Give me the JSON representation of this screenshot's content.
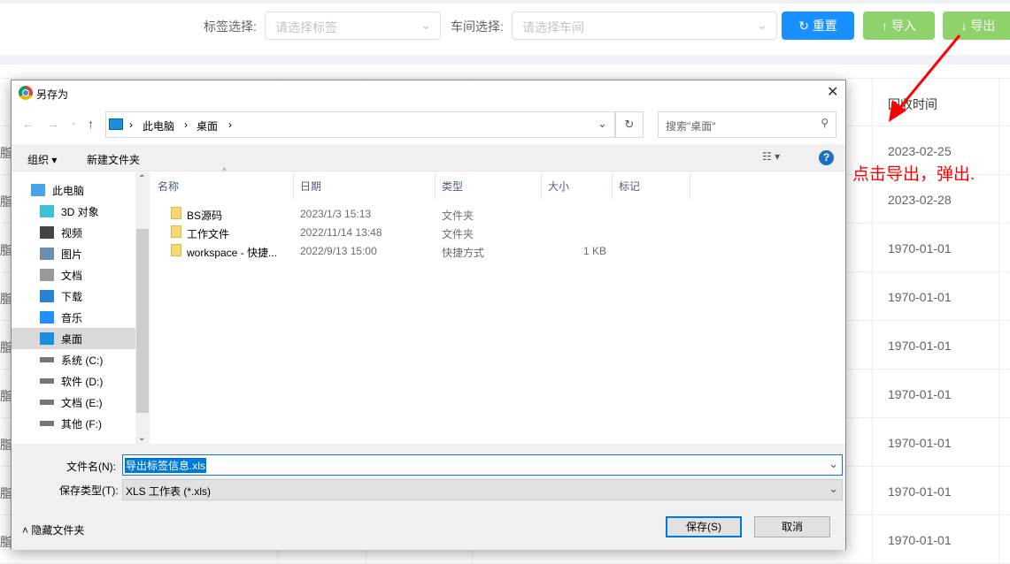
{
  "filters": {
    "tag_label": "标签选择:",
    "tag_placeholder": "请选择标签",
    "workshop_label": "车间选择:",
    "workshop_placeholder": "请选择车间"
  },
  "buttons": {
    "reset": "重置",
    "import": "导入",
    "export": "导出"
  },
  "colors": {
    "primary": "#1890ff",
    "success": "#8fd16a",
    "annotation": "#ff0000"
  },
  "table": {
    "column_header": "回收时间",
    "cut_text": "脂",
    "dates": [
      "2023-02-25",
      "2023-02-28",
      "1970-01-01",
      "1970-01-01",
      "1970-01-01",
      "1970-01-01",
      "1970-01-01",
      "1970-01-01",
      "1970-01-01"
    ]
  },
  "annotation": "点击导出，弹出.",
  "dialog": {
    "title": "另存为",
    "breadcrumb": [
      "此电脑",
      "桌面"
    ],
    "search_placeholder": "搜索\"桌面\"",
    "organize": "组织",
    "new_folder": "新建文件夹",
    "nav": [
      "此电脑",
      "3D 对象",
      "视频",
      "图片",
      "文档",
      "下载",
      "音乐",
      "桌面",
      "系统 (C:)",
      "软件 (D:)",
      "文档 (E:)",
      "其他 (F:)"
    ],
    "nav_selected": "桌面",
    "columns": [
      "名称",
      "日期",
      "类型",
      "大小",
      "标记"
    ],
    "files": [
      {
        "name": "BS源码",
        "date": "2023/1/3 15:13",
        "type": "文件夹",
        "size": ""
      },
      {
        "name": "工作文件",
        "date": "2022/11/14 13:48",
        "type": "文件夹",
        "size": ""
      },
      {
        "name": "workspace - 快捷...",
        "date": "2022/9/13 15:00",
        "type": "快捷方式",
        "size": "1 KB"
      }
    ],
    "filename_label": "文件名(N):",
    "filename": "导出标签信息.xls",
    "filetype_label": "保存类型(T):",
    "filetype": "XLS 工作表 (*.xls)",
    "hide_folders": "隐藏文件夹",
    "save": "保存(S)",
    "cancel": "取消"
  }
}
